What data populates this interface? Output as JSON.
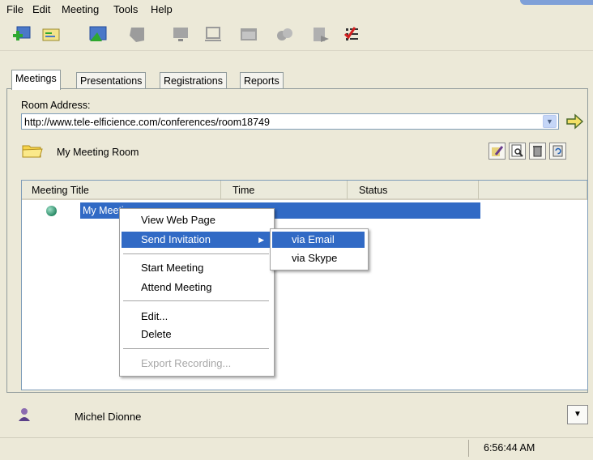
{
  "menu": [
    "File",
    "Edit",
    "Meeting",
    "Tools",
    "Help"
  ],
  "toolbar_icons": [
    "add-meeting-icon",
    "meeting-list-icon",
    "presentation-icon",
    "gray-slide-icon",
    "gray-monitor-icon",
    "gray-screen-icon",
    "gray-window-icon",
    "gray-camera-icon",
    "gray-document-icon",
    "checklist-icon"
  ],
  "tabs": [
    "Meetings",
    "Presentations",
    "Registrations",
    "Reports"
  ],
  "room": {
    "label": "Room Address:",
    "url": "http://www.tele-elficience.com/conferences/room18749",
    "name": "My Meeting Room"
  },
  "list": {
    "columns": [
      "Meeting Title",
      "Time",
      "Status"
    ],
    "rows": [
      {
        "title": "My Meeti",
        "time": "",
        "status": ""
      }
    ]
  },
  "context_menu": {
    "items": [
      "View Web Page",
      "Send Invitation",
      "Start Meeting",
      "Attend Meeting",
      "Edit...",
      "Delete",
      "Export Recording..."
    ],
    "submenu": [
      "via Email",
      "via Skype"
    ]
  },
  "user": {
    "name": "Michel Dionne"
  },
  "status": {
    "time": "6:56:44 AM"
  },
  "colors": {
    "accent": "#316ac5",
    "background": "#ece9d8"
  }
}
